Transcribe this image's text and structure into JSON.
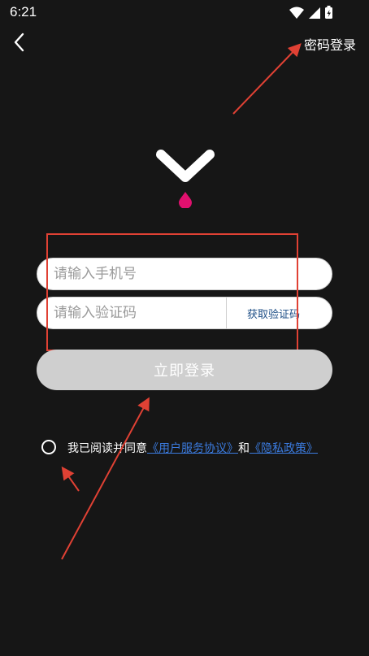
{
  "status_bar": {
    "time": "6:21",
    "icons": [
      "wifi-icon",
      "signal-icon",
      "battery-icon"
    ]
  },
  "header": {
    "back_icon": "chevron-left-icon",
    "password_login_label": "密码登录"
  },
  "logo": {
    "icon": "chevron-down-with-drop-logo",
    "drop_color": "#e0106e"
  },
  "form": {
    "phone_placeholder": "请输入手机号",
    "phone_value": "",
    "code_placeholder": "请输入验证码",
    "code_value": "",
    "get_code_label": "获取验证码",
    "submit_label": "立即登录"
  },
  "agreement": {
    "prefix": "我已阅读并同意",
    "user_agreement_link": "《用户服务协议》",
    "conjunction": "和",
    "privacy_link": "《隐私政策》",
    "checked": false
  },
  "colors": {
    "background": "#161616",
    "annotation_red": "#e04134",
    "link_blue": "#3b7bdf",
    "button_disabled": "#cfcfcf"
  }
}
